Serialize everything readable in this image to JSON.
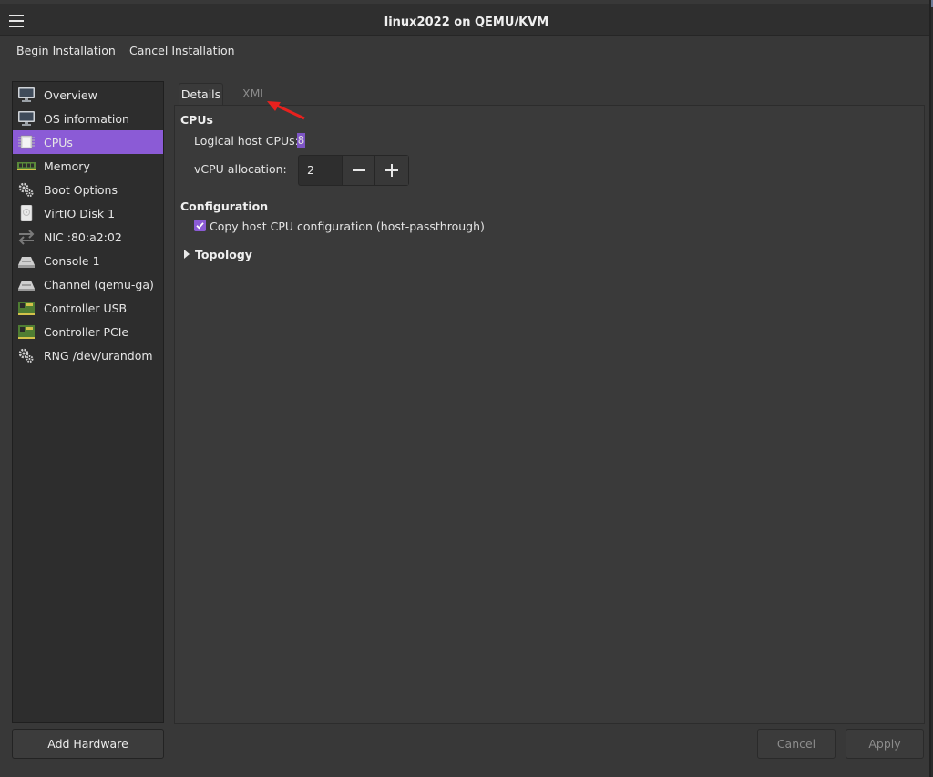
{
  "window": {
    "title": "linux2022 on QEMU/KVM"
  },
  "menubar": {
    "begin_installation": "Begin Installation",
    "cancel_installation": "Cancel Installation"
  },
  "sidebar": {
    "items": [
      {
        "label": "Overview",
        "icon": "monitor-icon"
      },
      {
        "label": "OS information",
        "icon": "monitor-icon"
      },
      {
        "label": "CPUs",
        "icon": "cpu-icon",
        "selected": true
      },
      {
        "label": "Memory",
        "icon": "memory-icon"
      },
      {
        "label": "Boot Options",
        "icon": "gears-icon"
      },
      {
        "label": "VirtIO Disk 1",
        "icon": "disk-icon"
      },
      {
        "label": "NIC :80:a2:02",
        "icon": "network-arrows-icon"
      },
      {
        "label": "Console 1",
        "icon": "console-icon"
      },
      {
        "label": "Channel (qemu-ga)",
        "icon": "console-icon"
      },
      {
        "label": "Controller USB",
        "icon": "controller-card-icon"
      },
      {
        "label": "Controller PCIe",
        "icon": "controller-card-icon"
      },
      {
        "label": "RNG /dev/urandom",
        "icon": "gears-icon"
      }
    ],
    "add_hardware": "Add Hardware"
  },
  "tabs": {
    "details": "Details",
    "xml": "XML",
    "active": "details"
  },
  "cpus": {
    "section_title": "CPUs",
    "logical_host_label": "Logical host CPUs:",
    "logical_host_value": "8",
    "vcpu_label": "vCPU allocation:",
    "vcpu_value": "2"
  },
  "configuration": {
    "section_title": "Configuration",
    "copy_host_label": "Copy host CPU configuration (host-passthrough)",
    "copy_host_checked": true
  },
  "topology": {
    "label": "Topology",
    "expanded": false
  },
  "footer": {
    "cancel": "Cancel",
    "apply": "Apply"
  },
  "colors": {
    "accent": "#8b5bd6",
    "annotation_arrow": "#e8211e"
  }
}
